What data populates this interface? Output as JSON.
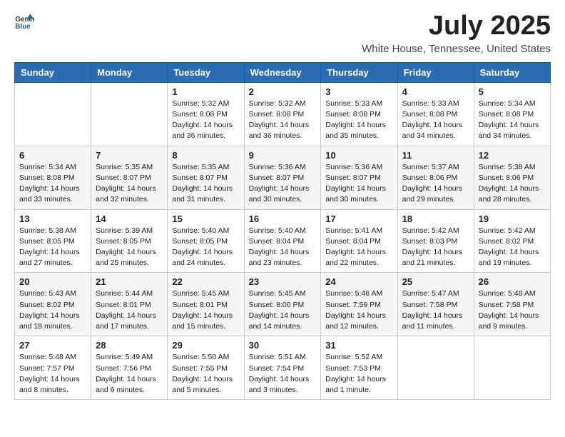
{
  "header": {
    "logo_general": "General",
    "logo_blue": "Blue",
    "month_title": "July 2025",
    "location": "White House, Tennessee, United States"
  },
  "weekdays": [
    "Sunday",
    "Monday",
    "Tuesday",
    "Wednesday",
    "Thursday",
    "Friday",
    "Saturday"
  ],
  "weeks": [
    [
      {
        "day": "",
        "content": ""
      },
      {
        "day": "",
        "content": ""
      },
      {
        "day": "1",
        "content": "Sunrise: 5:32 AM\nSunset: 8:08 PM\nDaylight: 14 hours and 36 minutes."
      },
      {
        "day": "2",
        "content": "Sunrise: 5:32 AM\nSunset: 8:08 PM\nDaylight: 14 hours and 36 minutes."
      },
      {
        "day": "3",
        "content": "Sunrise: 5:33 AM\nSunset: 8:08 PM\nDaylight: 14 hours and 35 minutes."
      },
      {
        "day": "4",
        "content": "Sunrise: 5:33 AM\nSunset: 8:08 PM\nDaylight: 14 hours and 34 minutes."
      },
      {
        "day": "5",
        "content": "Sunrise: 5:34 AM\nSunset: 8:08 PM\nDaylight: 14 hours and 34 minutes."
      }
    ],
    [
      {
        "day": "6",
        "content": "Sunrise: 5:34 AM\nSunset: 8:08 PM\nDaylight: 14 hours and 33 minutes."
      },
      {
        "day": "7",
        "content": "Sunrise: 5:35 AM\nSunset: 8:07 PM\nDaylight: 14 hours and 32 minutes."
      },
      {
        "day": "8",
        "content": "Sunrise: 5:35 AM\nSunset: 8:07 PM\nDaylight: 14 hours and 31 minutes."
      },
      {
        "day": "9",
        "content": "Sunrise: 5:36 AM\nSunset: 8:07 PM\nDaylight: 14 hours and 30 minutes."
      },
      {
        "day": "10",
        "content": "Sunrise: 5:36 AM\nSunset: 8:07 PM\nDaylight: 14 hours and 30 minutes."
      },
      {
        "day": "11",
        "content": "Sunrise: 5:37 AM\nSunset: 8:06 PM\nDaylight: 14 hours and 29 minutes."
      },
      {
        "day": "12",
        "content": "Sunrise: 5:38 AM\nSunset: 8:06 PM\nDaylight: 14 hours and 28 minutes."
      }
    ],
    [
      {
        "day": "13",
        "content": "Sunrise: 5:38 AM\nSunset: 8:05 PM\nDaylight: 14 hours and 27 minutes."
      },
      {
        "day": "14",
        "content": "Sunrise: 5:39 AM\nSunset: 8:05 PM\nDaylight: 14 hours and 25 minutes."
      },
      {
        "day": "15",
        "content": "Sunrise: 5:40 AM\nSunset: 8:05 PM\nDaylight: 14 hours and 24 minutes."
      },
      {
        "day": "16",
        "content": "Sunrise: 5:40 AM\nSunset: 8:04 PM\nDaylight: 14 hours and 23 minutes."
      },
      {
        "day": "17",
        "content": "Sunrise: 5:41 AM\nSunset: 8:04 PM\nDaylight: 14 hours and 22 minutes."
      },
      {
        "day": "18",
        "content": "Sunrise: 5:42 AM\nSunset: 8:03 PM\nDaylight: 14 hours and 21 minutes."
      },
      {
        "day": "19",
        "content": "Sunrise: 5:42 AM\nSunset: 8:02 PM\nDaylight: 14 hours and 19 minutes."
      }
    ],
    [
      {
        "day": "20",
        "content": "Sunrise: 5:43 AM\nSunset: 8:02 PM\nDaylight: 14 hours and 18 minutes."
      },
      {
        "day": "21",
        "content": "Sunrise: 5:44 AM\nSunset: 8:01 PM\nDaylight: 14 hours and 17 minutes."
      },
      {
        "day": "22",
        "content": "Sunrise: 5:45 AM\nSunset: 8:01 PM\nDaylight: 14 hours and 15 minutes."
      },
      {
        "day": "23",
        "content": "Sunrise: 5:45 AM\nSunset: 8:00 PM\nDaylight: 14 hours and 14 minutes."
      },
      {
        "day": "24",
        "content": "Sunrise: 5:46 AM\nSunset: 7:59 PM\nDaylight: 14 hours and 12 minutes."
      },
      {
        "day": "25",
        "content": "Sunrise: 5:47 AM\nSunset: 7:58 PM\nDaylight: 14 hours and 11 minutes."
      },
      {
        "day": "26",
        "content": "Sunrise: 5:48 AM\nSunset: 7:58 PM\nDaylight: 14 hours and 9 minutes."
      }
    ],
    [
      {
        "day": "27",
        "content": "Sunrise: 5:48 AM\nSunset: 7:57 PM\nDaylight: 14 hours and 8 minutes."
      },
      {
        "day": "28",
        "content": "Sunrise: 5:49 AM\nSunset: 7:56 PM\nDaylight: 14 hours and 6 minutes."
      },
      {
        "day": "29",
        "content": "Sunrise: 5:50 AM\nSunset: 7:55 PM\nDaylight: 14 hours and 5 minutes."
      },
      {
        "day": "30",
        "content": "Sunrise: 5:51 AM\nSunset: 7:54 PM\nDaylight: 14 hours and 3 minutes."
      },
      {
        "day": "31",
        "content": "Sunrise: 5:52 AM\nSunset: 7:53 PM\nDaylight: 14 hours and 1 minute."
      },
      {
        "day": "",
        "content": ""
      },
      {
        "day": "",
        "content": ""
      }
    ]
  ]
}
